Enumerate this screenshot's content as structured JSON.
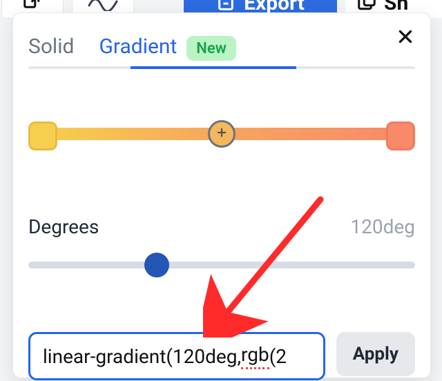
{
  "toolbar": {
    "export_label": "Export",
    "share_label": "Sh"
  },
  "tabs": {
    "solid": "Solid",
    "gradient": "Gradient",
    "badge": "New",
    "active_index": 1
  },
  "gradient": {
    "stops": [
      {
        "pos": 0,
        "color": "#f7cf4e"
      },
      {
        "pos": 100,
        "color": "#f88a6a"
      }
    ]
  },
  "degrees": {
    "label": "Degrees",
    "value_text": "120deg",
    "value": 120,
    "min": 0,
    "max": 360
  },
  "css_input": {
    "value_prefix": "linear-gradient(120deg, ",
    "value_spelled": "rgb",
    "value_suffix": "(2"
  },
  "apply_label": "Apply"
}
